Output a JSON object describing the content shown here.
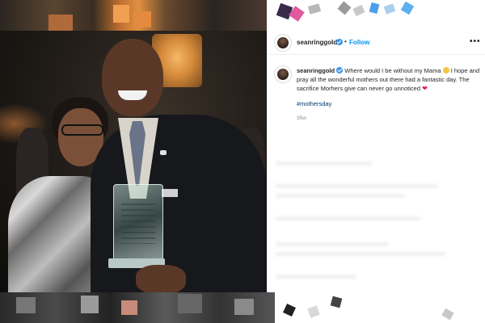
{
  "post": {
    "author": {
      "username": "seanringgold",
      "verified": true,
      "follow_label": "Follow",
      "separator": "•"
    },
    "more_label": "•••",
    "caption": {
      "username": "seanringgold",
      "text_1": "Where would I be without my Mama",
      "text_2": "I hope and pray all the wonderful mothers out there had a fantastic day. The sacrifice Morhers give can never go unnoticed",
      "emoji_1": "smiling-face-emoji",
      "emoji_2": "red-heart-emoji"
    },
    "hashtag": "#mothersday",
    "timestamp": "35w"
  },
  "colors": {
    "link_blue": "#0095f6",
    "hashtag": "#00376b",
    "verified": "#3897f0",
    "muted": "#8e8e8e",
    "heart": "#e0245e"
  },
  "icons": [
    "verified-badge-icon",
    "more-options-icon",
    "smile-emoji-icon",
    "heart-emoji-icon"
  ]
}
